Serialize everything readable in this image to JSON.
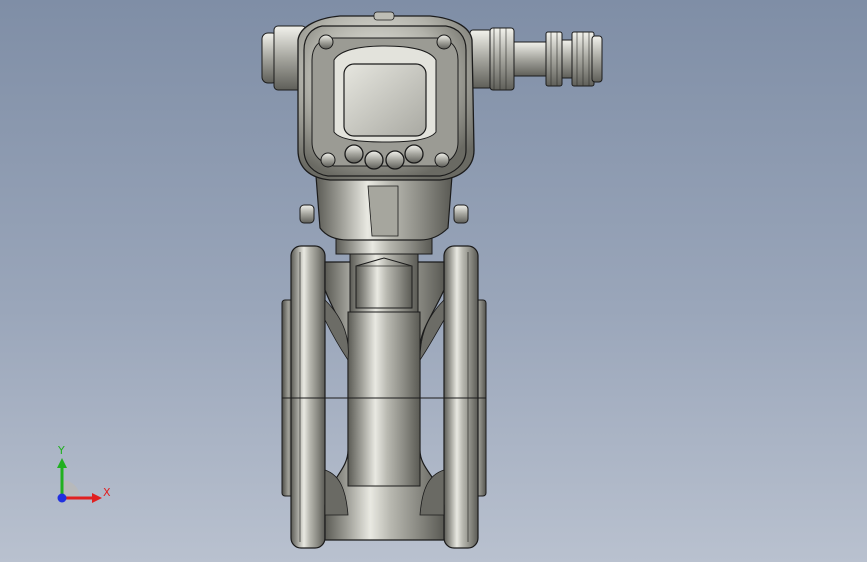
{
  "viewport": {
    "background_top": "#7f8ea6",
    "background_bottom": "#b9c1cf"
  },
  "model": {
    "shading": [
      "#5f5f58",
      "#8c8c84",
      "#c9c9c1",
      "#f1f1ea"
    ],
    "edge_color": "#1b1b1b",
    "display_screen_color": "#d7d7d0"
  },
  "triad": {
    "x_label": "X",
    "y_label": "Y",
    "x_color": "#e02020",
    "y_color": "#20b020",
    "z_color": "#2030e0"
  }
}
